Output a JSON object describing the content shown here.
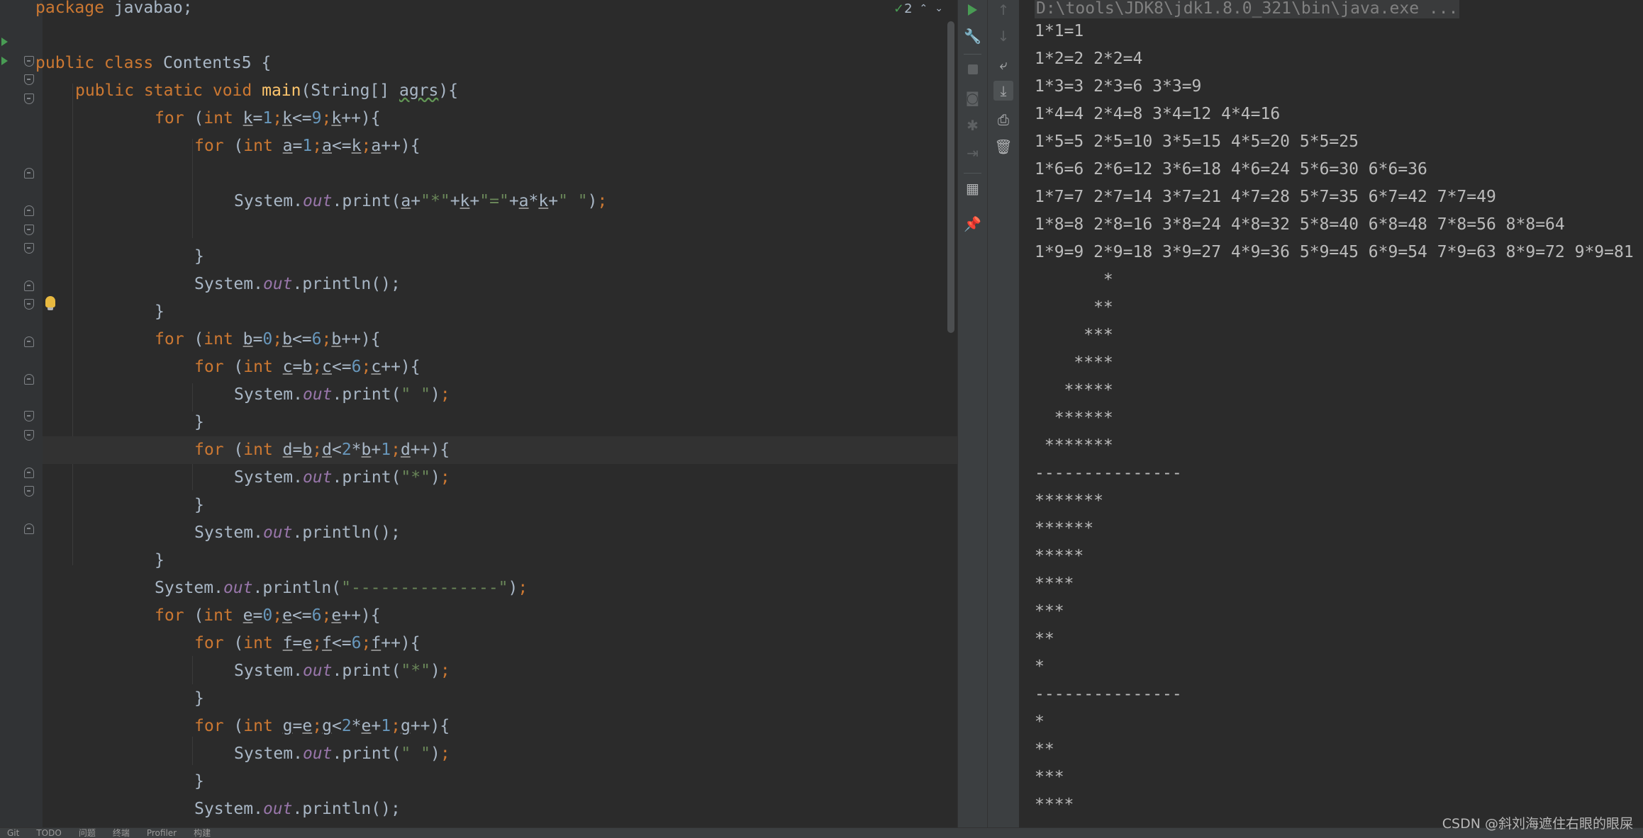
{
  "editor": {
    "inspection": {
      "warning_count": "2"
    },
    "code": {
      "l1_kw": "package",
      "l1_rest": " javabao;",
      "l3_kw": "public class",
      "l3_rest": " Contents5 {",
      "l4_kw": "public static void",
      "l4_fn": "main",
      "l4_a": "(String[] ",
      "l4_arg": "agrs",
      "l4_b": "){",
      "for_kw": "for",
      "int_kw": "int",
      "out": "out",
      "print": ".print(",
      "println": ".println();",
      "system": "System.",
      "l5": {
        "v": "k",
        "start": "1",
        "cond_op": "<=",
        "cond_val": "9"
      },
      "l6": {
        "v": "a",
        "start": "1",
        "cond_op": "<=",
        "cond_v2": "k"
      },
      "l8_a": "a",
      "l8_s1": "\"*\"",
      "l8_k": "k",
      "l8_s2": "\"=\"",
      "l8_a2": "a",
      "l8_k2": "k",
      "l8_s3": "\" \"",
      "close": "}",
      "l13": {
        "v": "b",
        "start": "0",
        "cond_op": "<=",
        "cond_val": "6"
      },
      "l14": {
        "v": "c",
        "start": "b",
        "cond_op": "<=",
        "cond_val": "6"
      },
      "str_space": "\" \"",
      "str_star": "\"*\"",
      "l17": {
        "v": "d",
        "start": "b",
        "cond_op": "<",
        "n2": "2",
        "v2": "b",
        "n1": "1"
      },
      "str_dash": "\"---------------\"",
      "l22": {
        "v": "e",
        "start": "0",
        "cond_op": "<=",
        "cond_val": "6"
      },
      "l23": {
        "v": "f",
        "start": "e",
        "cond_op": "<=",
        "cond_val": "6"
      },
      "l26": {
        "v": "g",
        "start": "e",
        "cond_op": "<",
        "n2": "2",
        "v2": "e",
        "n1": "1"
      }
    }
  },
  "console": {
    "command": "D:\\tools\\JDK8\\jdk1.8.0_321\\bin\\java.exe ...",
    "lines": [
      "1*1=1",
      "1*2=2 2*2=4",
      "1*3=3 2*3=6 3*3=9",
      "1*4=4 2*4=8 3*4=12 4*4=16",
      "1*5=5 2*5=10 3*5=15 4*5=20 5*5=25",
      "1*6=6 2*6=12 3*6=18 4*6=24 5*6=30 6*6=36",
      "1*7=7 2*7=14 3*7=21 4*7=28 5*7=35 6*7=42 7*7=49",
      "1*8=8 2*8=16 3*8=24 4*8=32 5*8=40 6*8=48 7*8=56 8*8=64",
      "1*9=9 2*9=18 3*9=27 4*9=36 5*9=45 6*9=54 7*9=63 8*9=72 9*9=81",
      "       *",
      "      **",
      "     ***",
      "    ****",
      "   *****",
      "  ******",
      " *******",
      "---------------",
      "*******",
      "******",
      "*****",
      "****",
      "***",
      "**",
      "*",
      "---------------",
      "*",
      "**",
      "***",
      "****"
    ]
  },
  "statusbar": {
    "items": [
      "Git",
      "TODO",
      "问题",
      "终端",
      "Profiler",
      "构建"
    ]
  },
  "watermark": "CSDN @斜刘海遮住右眼的眼屎",
  "colors": {
    "background": "#2b2b2b",
    "gutter": "#313335",
    "keyword": "#cc7832",
    "function": "#ffc66d",
    "string": "#6a8759",
    "number": "#6897bb",
    "field": "#9876aa",
    "text": "#a9b7c6",
    "run_green": "#499c54"
  },
  "icons": [
    "run-icon",
    "wrench-icon",
    "stop-icon",
    "camera-icon",
    "debug-icon",
    "exit-icon",
    "layout-icon",
    "pin-icon",
    "up-arrow-icon",
    "down-arrow-icon",
    "soft-wrap-icon",
    "scroll-to-end-icon",
    "print-icon",
    "trash-icon"
  ]
}
